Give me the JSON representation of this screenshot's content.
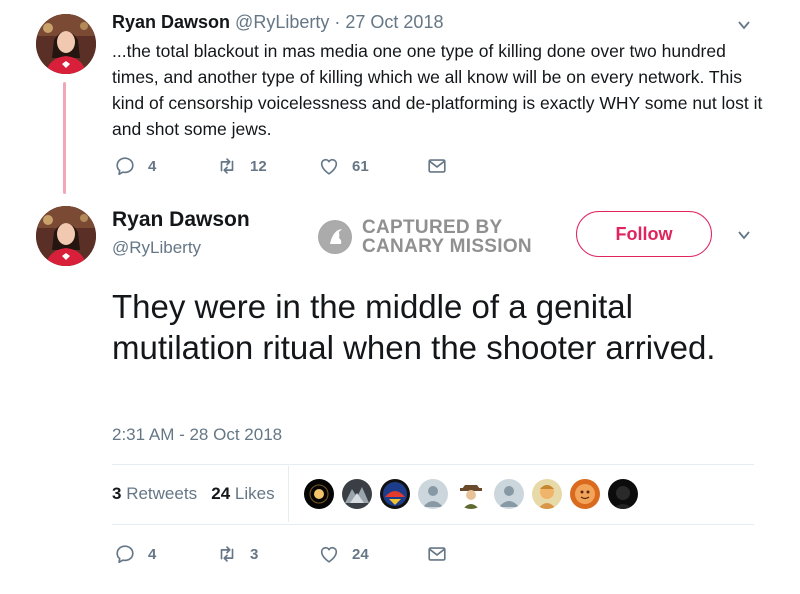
{
  "reply_tweet": {
    "name": "Ryan Dawson",
    "handle": "@RyLiberty",
    "separator": "·",
    "date": "27 Oct 2018",
    "text": "...the total blackout in mas media one one type of killing done over two hundred times, and another type of killing which we all know will be on every network. This kind of censorship voicelessness and de-platforming is exactly WHY some nut lost it and shot some jews.",
    "replies": "4",
    "retweets": "12",
    "likes": "61"
  },
  "main_tweet": {
    "name": "Ryan Dawson",
    "handle": "@RyLiberty",
    "follow_label": "Follow",
    "text": "They were in the middle of a genital mutilation ritual when the shooter arrived.",
    "timestamp": "2:31 AM - 28 Oct 2018",
    "retweet_count": "3",
    "retweet_label": "Retweets",
    "like_count": "24",
    "like_label": "Likes",
    "replies": "4",
    "retweets": "3",
    "likes": "24"
  },
  "watermark": {
    "line1": "CAPTURED BY",
    "line2": "CANARY MISSION"
  },
  "icons": [
    "reply-icon",
    "retweet-icon",
    "like-icon",
    "dm-icon",
    "caret-down-icon"
  ],
  "colors": {
    "accent": "#e0245e",
    "muted": "#657786",
    "thread_line": "#f0a8b8",
    "text": "#14171a"
  }
}
